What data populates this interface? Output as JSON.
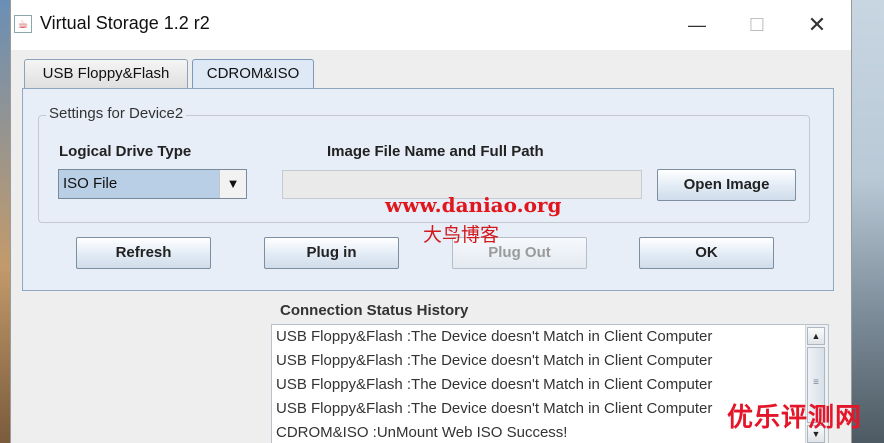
{
  "window": {
    "title": "Virtual Storage 1.2 r2",
    "controls": {
      "minimize": "—",
      "maximize": "☐",
      "close": "✕"
    }
  },
  "tabs": [
    {
      "label": "USB Floppy&Flash",
      "active": false
    },
    {
      "label": "CDROM&ISO",
      "active": true
    }
  ],
  "settings": {
    "group_title": "Settings for Device2",
    "drive_type_label": "Logical Drive Type",
    "drive_type_value": "ISO File",
    "image_path_label": "Image File Name and Full Path",
    "image_path_value": "",
    "open_image_label": "Open Image"
  },
  "buttons": {
    "refresh": "Refresh",
    "plug_in": "Plug in",
    "plug_out": "Plug Out",
    "ok": "OK"
  },
  "watermarks": {
    "site": "www.daniao.org",
    "site_cn": "大鸟博客",
    "corner": "优乐评测网"
  },
  "status": {
    "title": "Connection Status History",
    "rows": [
      "USB Floppy&Flash :The Device doesn't Match in Client Computer",
      "USB Floppy&Flash :The Device doesn't Match in Client Computer",
      "USB Floppy&Flash :The Device doesn't Match in Client Computer",
      "USB Floppy&Flash :The Device doesn't Match in Client Computer",
      "CDROM&ISO :UnMount Web ISO Success!"
    ]
  },
  "colors": {
    "panel_bg": "#e7eef7",
    "selected_value_bg": "#b8cfe6",
    "watermark_red": "#e0161c"
  }
}
